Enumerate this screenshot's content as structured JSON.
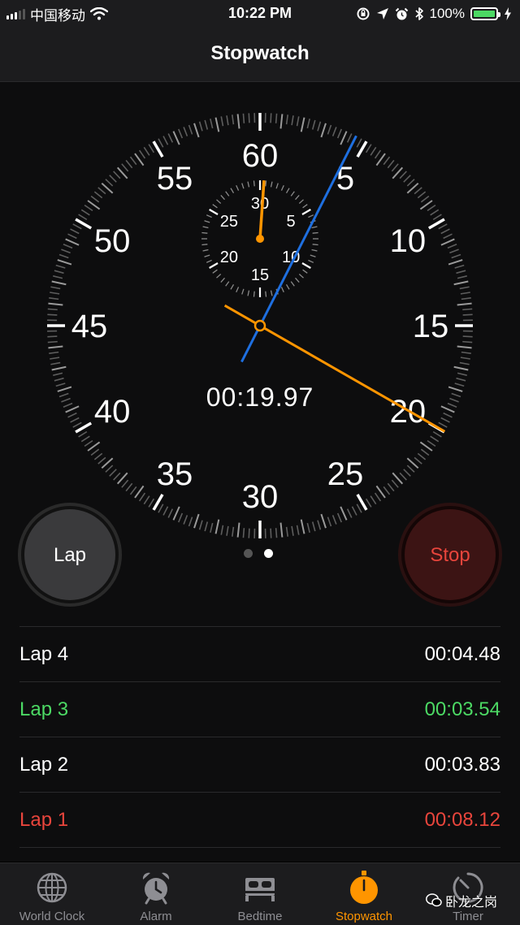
{
  "status_bar": {
    "carrier": "中国移动",
    "time": "10:22 PM",
    "battery": "100%",
    "battery_level": 1.0
  },
  "nav": {
    "title": "Stopwatch"
  },
  "dial": {
    "outer_labels": [
      "60",
      "5",
      "10",
      "15",
      "20",
      "25",
      "30",
      "35",
      "40",
      "45",
      "50",
      "55"
    ],
    "inner_labels": [
      "30",
      "5",
      "10",
      "15",
      "20",
      "25"
    ],
    "digital_time": "00:19.97",
    "second_hand_seconds": 19.97,
    "lap_hand_seconds": 4.48,
    "minute_hand_minutes": 0.33,
    "colors": {
      "second_hand": "#ff9500",
      "lap_hand": "#1e6fe0",
      "minute_hand": "#ff9500"
    }
  },
  "buttons": {
    "lap": "Lap",
    "stop": "Stop"
  },
  "page_dots": {
    "count": 2,
    "active": 1
  },
  "laps": [
    {
      "label": "Lap 4",
      "time": "00:04.48",
      "status": "normal"
    },
    {
      "label": "Lap 3",
      "time": "00:03.54",
      "status": "best"
    },
    {
      "label": "Lap 2",
      "time": "00:03.83",
      "status": "normal"
    },
    {
      "label": "Lap 1",
      "time": "00:08.12",
      "status": "worst"
    }
  ],
  "tabs": [
    {
      "label": "World Clock",
      "icon": "globe-icon",
      "active": false
    },
    {
      "label": "Alarm",
      "icon": "alarm-clock-icon",
      "active": false
    },
    {
      "label": "Bedtime",
      "icon": "bed-icon",
      "active": false
    },
    {
      "label": "Stopwatch",
      "icon": "stopwatch-icon",
      "active": true
    },
    {
      "label": "Timer",
      "icon": "timer-icon",
      "active": false
    }
  ],
  "watermark": "卧龙之岗"
}
